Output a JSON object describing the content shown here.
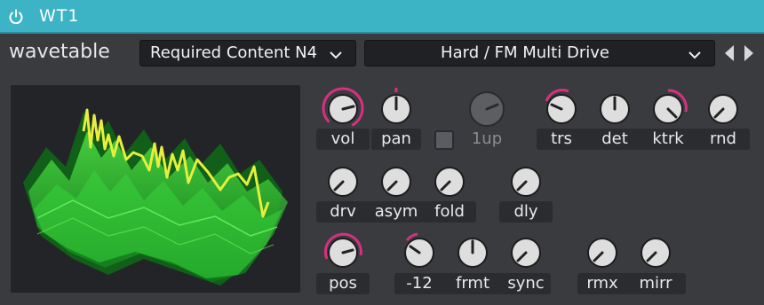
{
  "title_bar": {
    "title": "WT1",
    "power_icon": "power-icon",
    "accent": "#3cb4c6"
  },
  "header": {
    "section_label": "wavetable",
    "category_value": "Required Content N4",
    "preset_value": "Hard / FM Multi Drive",
    "prev_icon": "triangle-left-icon",
    "next_icon": "triangle-right-icon"
  },
  "knobs": {
    "row1": {
      "vol": "vol",
      "pan": "pan",
      "one_up": "1up",
      "trs": "trs",
      "det": "det",
      "ktrk": "ktrk",
      "rnd": "rnd"
    },
    "row2": {
      "drv": "drv",
      "asym": "asym",
      "fold": "fold",
      "dly": "dly"
    },
    "row3": {
      "pos": "pos",
      "pitch": "-12",
      "frmt": "frmt",
      "sync": "sync",
      "rmx": "rmx",
      "mirr": "mirr"
    }
  },
  "one_up_checkbox": {
    "checked": false
  },
  "colors": {
    "knob_arc": "#d4317f",
    "waveform_green": "#2fd63a",
    "waveform_highlight": "#e5ef3c"
  }
}
